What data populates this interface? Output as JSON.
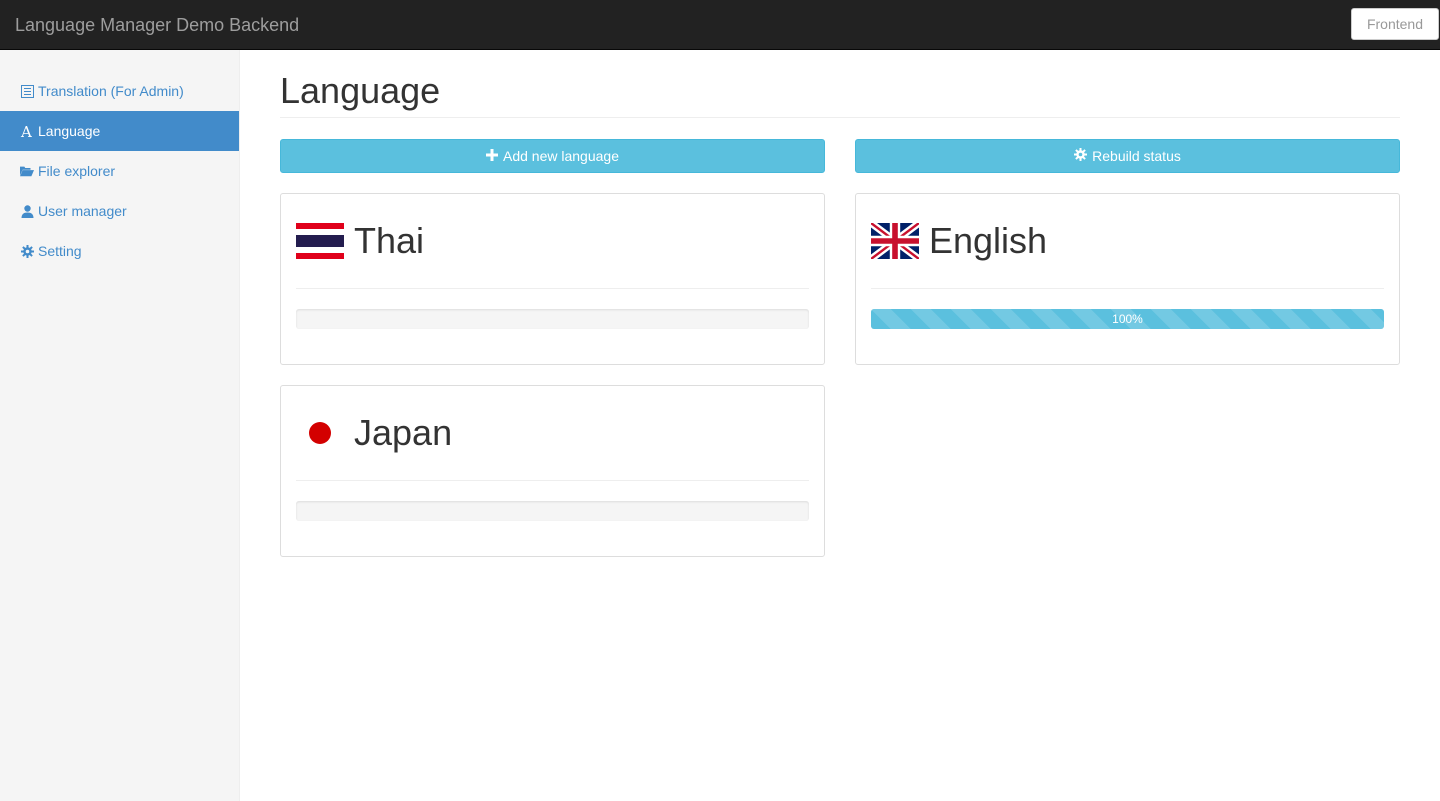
{
  "navbar": {
    "brand": "Language Manager Demo Backend",
    "frontend_label": "Frontend"
  },
  "sidebar": {
    "items": [
      {
        "label": "Translation (For Admin)",
        "icon": "list-icon",
        "active": false
      },
      {
        "label": "Language",
        "icon": "font-icon",
        "active": true
      },
      {
        "label": "File explorer",
        "icon": "folder-open-icon",
        "active": false
      },
      {
        "label": "User manager",
        "icon": "user-icon",
        "active": false
      },
      {
        "label": "Setting",
        "icon": "gear-icon",
        "active": false
      }
    ]
  },
  "main": {
    "title": "Language",
    "add_button_label": "Add new language",
    "rebuild_button_label": "Rebuild status",
    "languages": [
      {
        "name": "Thai",
        "flag": "thailand-flag-icon",
        "progress": 0,
        "progress_label": ""
      },
      {
        "name": "English",
        "flag": "uk-flag-icon",
        "progress": 100,
        "progress_label": "100%"
      },
      {
        "name": "Japan",
        "flag": "japan-flag-icon",
        "progress": 0,
        "progress_label": ""
      }
    ]
  },
  "colors": {
    "navbar": "#222222",
    "primary": "#428bca",
    "info": "#5bc0de"
  }
}
